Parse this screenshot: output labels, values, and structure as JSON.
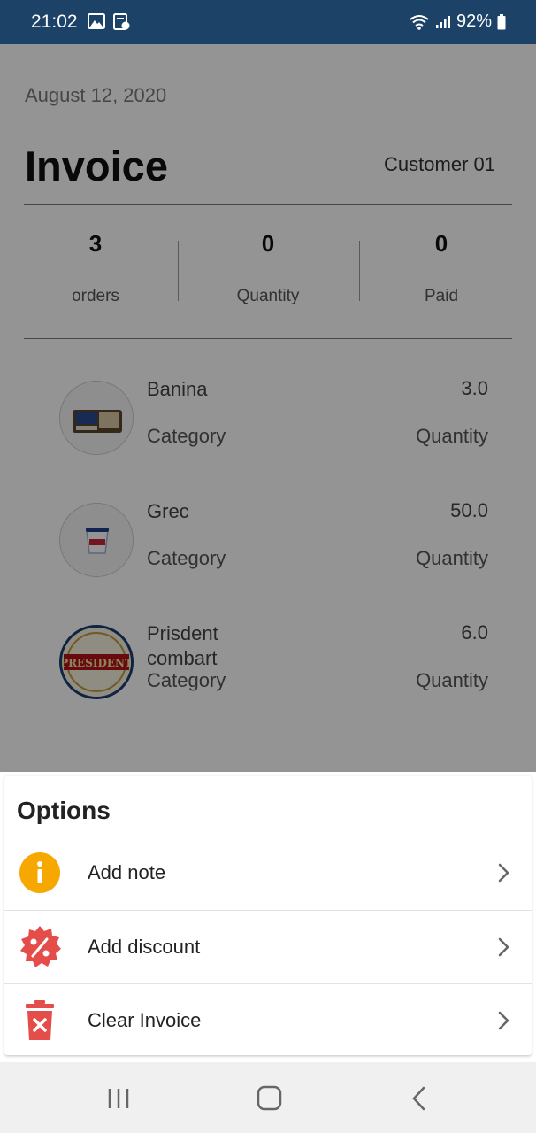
{
  "status_bar": {
    "time": "21:02",
    "battery": "92%"
  },
  "header": {
    "date": "August 12, 2020",
    "title": "Invoice",
    "customer": "Customer 01"
  },
  "stats": [
    {
      "value": "3",
      "label": "orders"
    },
    {
      "value": "0",
      "label": "Quantity"
    },
    {
      "value": "0",
      "label": "Paid"
    }
  ],
  "items": [
    {
      "name": "Banina",
      "category": "Category",
      "quantity": "3.0",
      "quantity_label": "Quantity"
    },
    {
      "name": "Grec",
      "category": "Category",
      "quantity": "50.0",
      "quantity_label": "Quantity"
    },
    {
      "name": "Prisdent combart",
      "category": "Category",
      "quantity": "6.0",
      "quantity_label": "Quantity",
      "logo_text": "PRESIDENT"
    }
  ],
  "options_sheet": {
    "title": "Options",
    "options": [
      {
        "label": "Add note",
        "icon": "info-icon",
        "color": "#f7a800"
      },
      {
        "label": "Add discount",
        "icon": "discount-icon",
        "color": "#e54d4b"
      },
      {
        "label": "Clear Invoice",
        "icon": "trash-icon",
        "color": "#e54d4b"
      }
    ]
  },
  "colors": {
    "status_bar": "#1d4267"
  }
}
